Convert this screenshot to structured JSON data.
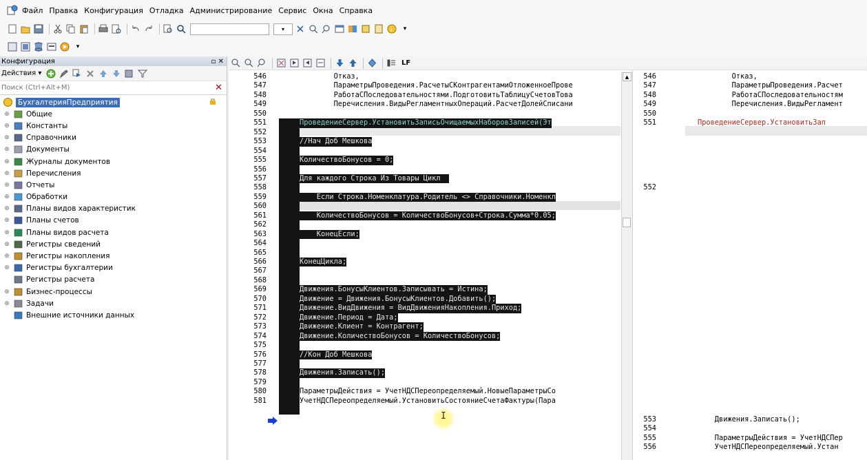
{
  "menu": {
    "items": [
      {
        "label": "Файл",
        "u": true
      },
      {
        "label": "Правка",
        "u": true
      },
      {
        "label": "Конфигурация",
        "u": false
      },
      {
        "label": "Отладка",
        "u": false
      },
      {
        "label": "Администрирование",
        "u": false
      },
      {
        "label": "Сервис",
        "u": true
      },
      {
        "label": "Окна",
        "u": true
      },
      {
        "label": "Справка",
        "u": false
      }
    ]
  },
  "left_panel": {
    "title": "Конфигурация",
    "title_controls": "▫ ✕",
    "actions_label": "Действия ▾",
    "search_placeholder": "Поиск (Ctrl+Alt+M)",
    "root": "БухгалтерияПредприятия",
    "items": [
      {
        "label": "Общие",
        "icon": "general-icon",
        "exp": "⊕"
      },
      {
        "label": "Константы",
        "icon": "constants-icon",
        "exp": "⊕"
      },
      {
        "label": "Справочники",
        "icon": "catalogs-icon",
        "exp": "⊕"
      },
      {
        "label": "Документы",
        "icon": "documents-icon",
        "exp": "⊕"
      },
      {
        "label": "Журналы документов",
        "icon": "journals-icon",
        "exp": "⊕"
      },
      {
        "label": "Перечисления",
        "icon": "enums-icon",
        "exp": "⊕"
      },
      {
        "label": "Отчеты",
        "icon": "reports-icon",
        "exp": "⊕"
      },
      {
        "label": "Обработки",
        "icon": "dataprocessors-icon",
        "exp": "⊕"
      },
      {
        "label": "Планы видов характеристик",
        "icon": "chart-of-characteristics-icon",
        "exp": "⊕"
      },
      {
        "label": "Планы счетов",
        "icon": "chart-of-accounts-icon",
        "exp": "⊕"
      },
      {
        "label": "Планы видов расчета",
        "icon": "calculation-types-icon",
        "exp": "⊕"
      },
      {
        "label": "Регистры сведений",
        "icon": "info-registers-icon",
        "exp": "⊕"
      },
      {
        "label": "Регистры накопления",
        "icon": "accumulation-registers-icon",
        "exp": "⊕"
      },
      {
        "label": "Регистры бухгалтерии",
        "icon": "accounting-registers-icon",
        "exp": "⊕"
      },
      {
        "label": "Регистры расчета",
        "icon": "calculation-registers-icon",
        "exp": ""
      },
      {
        "label": "Бизнес-процессы",
        "icon": "business-processes-icon",
        "exp": "⊕"
      },
      {
        "label": "Задачи",
        "icon": "tasks-icon",
        "exp": "⊕"
      },
      {
        "label": "Внешние источники данных",
        "icon": "external-sources-icon",
        "exp": ""
      }
    ]
  },
  "code_toolbar": {
    "lf": "LF"
  },
  "left_code": [
    {
      "n": "546",
      "t": "        Отказ,",
      "style": "plain"
    },
    {
      "n": "547",
      "t": "        ПараметрыПроведения.РасчетыСКонтрагентамиОтложенноеПрове",
      "style": "plain"
    },
    {
      "n": "548",
      "t": "        РаботаСПоследовательностями.ПодготовитьТаблицуСчетовТова",
      "style": "plain"
    },
    {
      "n": "549",
      "t": "        Перечисления.ВидыРегламентныхОпераций.РасчетДолейСписани",
      "style": "plain"
    },
    {
      "n": "550",
      "t": "",
      "style": "plain"
    },
    {
      "n": "551",
      "t": "ПроведениеСервер.УстановитьЗаписьОчищаемыхНаборовЗаписей(Эт",
      "style": "cyan"
    },
    {
      "n": "552",
      "t": "",
      "style": "plain"
    },
    {
      "n": "553",
      "t": "//Нач Доб Мешкова",
      "style": "hl"
    },
    {
      "n": "554",
      "t": "",
      "style": "plain"
    },
    {
      "n": "555",
      "t": "КоличествоБонусов = 0;",
      "style": "hl"
    },
    {
      "n": "556",
      "t": "",
      "style": "plain"
    },
    {
      "n": "557",
      "t": "Для каждого Строка Из Товары Цикл  ",
      "style": "hl"
    },
    {
      "n": "558",
      "t": "",
      "style": "plain"
    },
    {
      "n": "559",
      "t": "    Если Строка.Номенклатура.Родитель <> Справочники.Номенкл",
      "style": "hl"
    },
    {
      "n": "560",
      "t": "",
      "style": "plain"
    },
    {
      "n": "561",
      "t": "    КоличествоБонусов = КоличествоБонусов+Строка.Сумма*0.05;",
      "style": "hl"
    },
    {
      "n": "562",
      "t": "",
      "style": "plain"
    },
    {
      "n": "563",
      "t": "    КонецЕсли;",
      "style": "hl"
    },
    {
      "n": "564",
      "t": "",
      "style": "plain"
    },
    {
      "n": "565",
      "t": "",
      "style": "plain"
    },
    {
      "n": "566",
      "t": "КонецЦикла;",
      "style": "hl"
    },
    {
      "n": "567",
      "t": "",
      "style": "plain"
    },
    {
      "n": "568",
      "t": "",
      "style": "plain"
    },
    {
      "n": "569",
      "t": "Движения.БонусыКлиентов.Записывать = Истина;",
      "style": "hl"
    },
    {
      "n": "570",
      "t": "Движение = Движения.БонусыКлиентов.Добавить();",
      "style": "hl"
    },
    {
      "n": "571",
      "t": "Движение.ВидДвижения = ВидДвиженияНакопления.Приход;",
      "style": "hl"
    },
    {
      "n": "572",
      "t": "Движение.Период = Дата;",
      "style": "hl"
    },
    {
      "n": "573",
      "t": "Движение.Клиент = Контрагент;",
      "style": "hl"
    },
    {
      "n": "574",
      "t": "Движение.КоличествоБонусов = КоличествоБонусов;",
      "style": "hl"
    },
    {
      "n": "575",
      "t": "",
      "style": "plain"
    },
    {
      "n": "576",
      "t": "//Кон Доб Мешкова",
      "style": "hl"
    },
    {
      "n": "577",
      "t": "",
      "style": "plain"
    },
    {
      "n": "578",
      "t": "Движения.Записать();",
      "style": "hl"
    },
    {
      "n": "579",
      "t": "",
      "style": "plain"
    },
    {
      "n": "580",
      "t": "ПараметрыДействия = УчетНДСПереопределяемый.НовыеПараметрыСо",
      "style": "plain"
    },
    {
      "n": "581",
      "t": "УчетНДСПереопределяемый.УстановитьСостояниеСчетаФактуры(Пара",
      "style": "plain"
    }
  ],
  "right_code": [
    {
      "n": "546",
      "t": "        Отказ,",
      "row": 0,
      "style": "plain"
    },
    {
      "n": "547",
      "t": "        ПараметрыПроведения.Расчет",
      "row": 1,
      "style": "plain"
    },
    {
      "n": "548",
      "t": "        РаботаСПоследовательностям",
      "row": 2,
      "style": "plain"
    },
    {
      "n": "549",
      "t": "        Перечисления.ВидыРегламент",
      "row": 3,
      "style": "plain"
    },
    {
      "n": "550",
      "t": "",
      "row": 4,
      "style": "plain"
    },
    {
      "n": "551",
      "t": "ПроведениеСервер.УстановитьЗап",
      "row": 5,
      "style": "red"
    },
    {
      "n": "552",
      "t": "",
      "row": 12,
      "style": "plain"
    },
    {
      "n": "553",
      "t": "    Движения.Записать();",
      "row": 37,
      "style": "plain"
    },
    {
      "n": "554",
      "t": "",
      "row": 38,
      "style": "plain"
    },
    {
      "n": "555",
      "t": "    ПараметрыДействия = УчетНДСПер",
      "row": 39,
      "style": "plain"
    },
    {
      "n": "556",
      "t": "    УчетНДСПереопределяемый.Устан",
      "row": 40,
      "style": "plain"
    }
  ],
  "colors": {
    "selection": "#141414",
    "tree_selected": "#3d6eb5",
    "changed_line": "#b02a1f"
  }
}
